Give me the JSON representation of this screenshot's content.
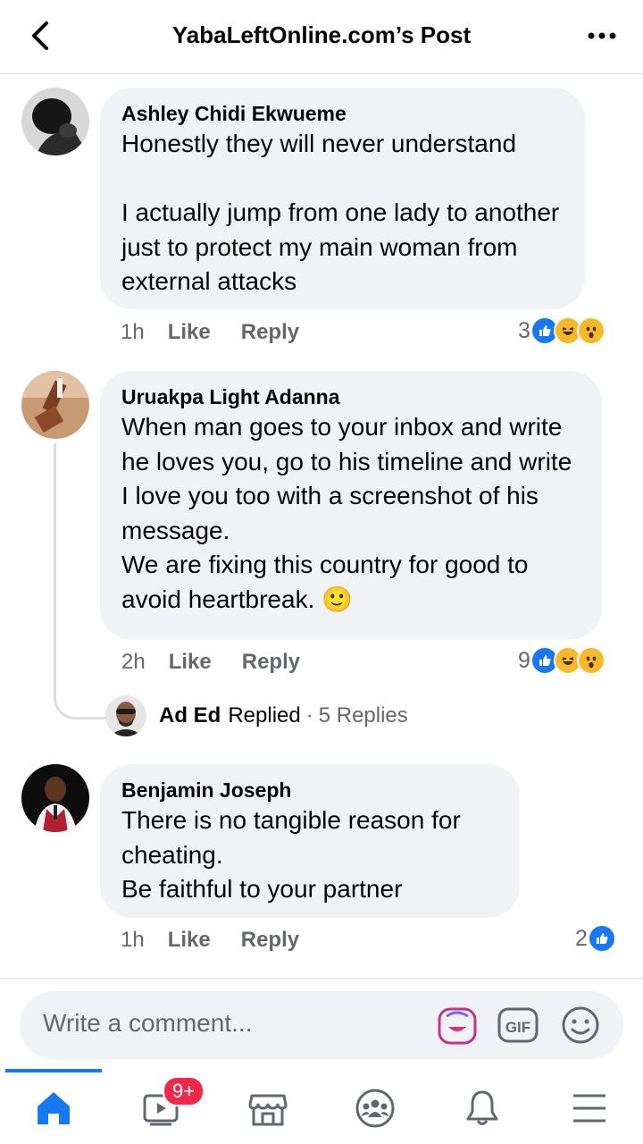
{
  "header": {
    "title": "YabaLeftOnline.com’s Post"
  },
  "comments": [
    {
      "author": "Ashley Chidi Ekwueme",
      "text": "Honestly they will never understand\n\nI actually jump from one lady to another just to protect my main woman from external attacks",
      "time": "1h",
      "like": "Like",
      "reply": "Reply",
      "reaction_count": "3",
      "reactions": [
        "like",
        "haha",
        "wow"
      ]
    },
    {
      "author": "Uruakpa Light Adanna",
      "text": "When man goes to your inbox and write he loves you, go to his timeline and write I love you too with a screenshot of his message.\nWe are fixing this country for good to avoid heartbreak. 🙂",
      "time": "2h",
      "like": "Like",
      "reply": "Reply",
      "reaction_count": "9",
      "reactions": [
        "like",
        "haha",
        "wow"
      ],
      "reply_summary": {
        "name": "Ad Ed",
        "verb": "Replied",
        "separator": "·",
        "count": "5 Replies"
      }
    },
    {
      "author": "Benjamin Joseph",
      "text": "There is no tangible reason for cheating.\nBe faithful to your partner",
      "time": "1h",
      "like": "Like",
      "reply": "Reply",
      "reaction_count": "2",
      "reactions": [
        "like"
      ]
    }
  ],
  "composer": {
    "placeholder": "Write a comment...",
    "icons": [
      "avatar-sticker-icon",
      "gif-icon",
      "emoji-icon"
    ]
  },
  "nav": {
    "items": [
      "home-icon",
      "watch-icon",
      "marketplace-icon",
      "groups-icon",
      "notifications-icon",
      "menu-icon"
    ],
    "watch_badge": "9+",
    "active": "home"
  },
  "colors": {
    "accent": "#1877f2",
    "bubble": "#f0f2f5",
    "secondary_text": "#65676b",
    "badge": "#f02849",
    "reaction_yellow": "#f7b928"
  }
}
